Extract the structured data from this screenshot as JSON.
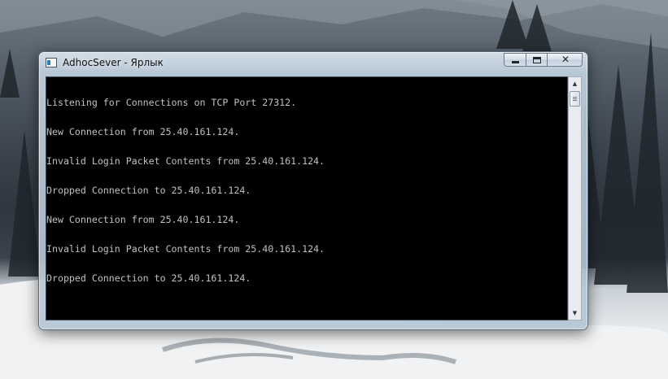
{
  "window": {
    "title": "AdhocSever - Ярлык",
    "icon": "console-window-icon",
    "controls": {
      "minimize": "minimize-icon",
      "maximize": "maximize-icon",
      "close": "close-icon",
      "close_glyph": "✕"
    }
  },
  "console": {
    "lines": [
      "Listening for Connections on TCP Port 27312.",
      "New Connection from 25.40.161.124.",
      "Invalid Login Packet Contents from 25.40.161.124.",
      "Dropped Connection to 25.40.161.124.",
      "New Connection from 25.40.161.124.",
      "Invalid Login Packet Contents from 25.40.161.124.",
      "Dropped Connection to 25.40.161.124."
    ],
    "background_color": "#000000",
    "text_color": "#c0c0c0"
  },
  "scrollbar": {
    "up_glyph": "▲",
    "down_glyph": "▼"
  }
}
